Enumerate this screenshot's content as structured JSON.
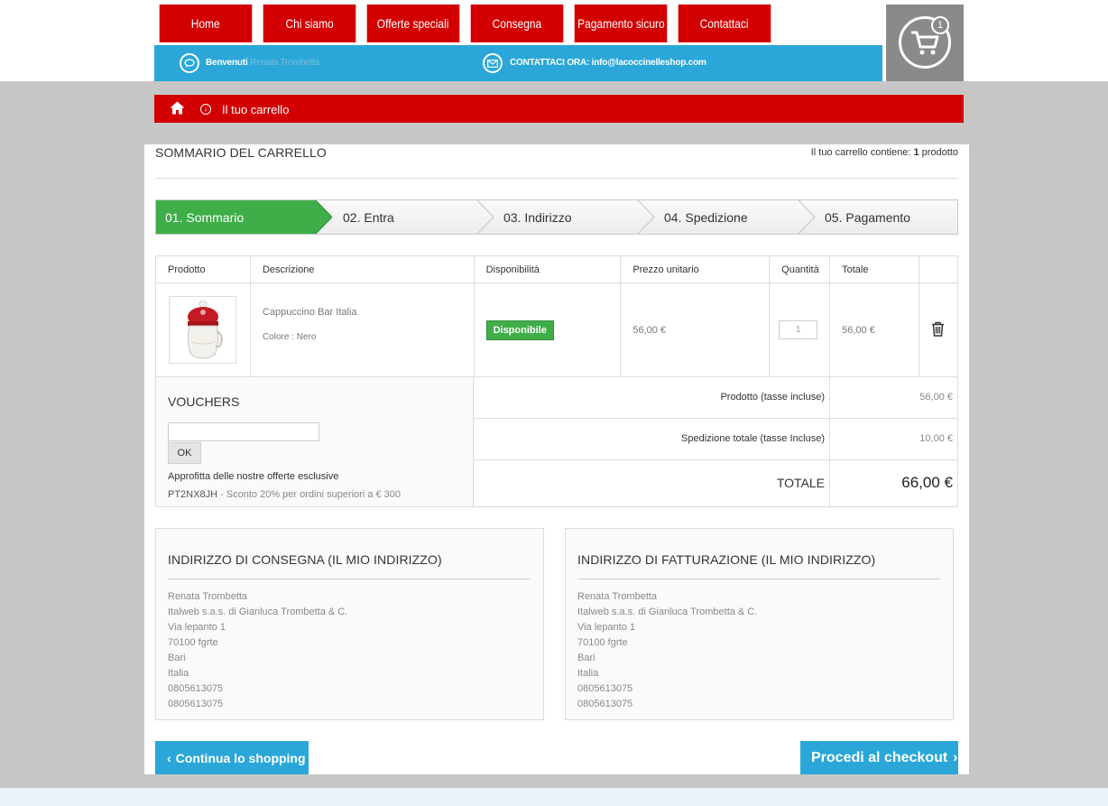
{
  "nav": [
    "Home",
    "Chi siamo",
    "Offerte speciali",
    "Consegna",
    "Pagamento sicuro",
    "Contattaci"
  ],
  "infobar": {
    "welcome_label": "Benvenuti",
    "user_name": "Renata Trombetta",
    "contact_text": "CONTATTACI ORA: info@lacoccinelleshop.com"
  },
  "cart": {
    "count": "1"
  },
  "breadcrumb": {
    "current": "Il tuo carrello"
  },
  "summary_title": "SOMMARIO DEL CARRELLO",
  "cart_count_prefix": "Il tuo carrello contiene:",
  "cart_count_num": "1",
  "cart_count_suffix": "prodotto",
  "steps": [
    "01. Sommario",
    "02. Entra",
    "03. Indirizzo",
    "04. Spedizione",
    "05. Pagamento"
  ],
  "table": {
    "headers": [
      "Prodotto",
      "Descrizione",
      "Disponibilità",
      "Prezzo unitario",
      "Quantità",
      "Totale"
    ],
    "row": {
      "name": "Cappuccino Bar Italia",
      "attr": "Colore : Nero",
      "availability": "Disponibile",
      "unit_price": "56,00 €",
      "qty": "1",
      "total": "56,00 €"
    }
  },
  "vouchers": {
    "title": "VOUCHERS",
    "ok_label": "OK",
    "offer_text": "Approfitta delle nostre offerte esclusive",
    "code": "PT2NX8JH",
    "code_desc": " - Sconto 20% per ordini superiori a € 300"
  },
  "totals": {
    "products_label": "Prodotto (tasse incluse)",
    "products_value": "56,00 €",
    "shipping_label": "Spedizione totale (tasse Incluse)",
    "shipping_value": "10,00 €",
    "total_label": "TOTALE",
    "total_value": "66,00 €"
  },
  "delivery": {
    "title": "INDIRIZZO DI CONSEGNA (IL MIO INDIRIZZO)",
    "lines": [
      "Renata Trombetta",
      "Italweb s.a.s. di Gianluca Trombetta & C.",
      "Via lepanto 1",
      "70100 fgrte",
      "Bari",
      "Italia",
      "0805613075",
      "0805613075"
    ]
  },
  "billing": {
    "title": "INDIRIZZO DI FATTURAZIONE (IL MIO INDIRIZZO)",
    "lines": [
      "Renata Trombetta",
      "Italweb s.a.s. di Gianluca Trombetta & C.",
      "Via lepanto 1",
      "70100 fgrte",
      "Bari",
      "Italia",
      "0805613075",
      "0805613075"
    ]
  },
  "buttons": {
    "continue": "Continua lo shopping",
    "checkout": "Procedi al checkout"
  }
}
